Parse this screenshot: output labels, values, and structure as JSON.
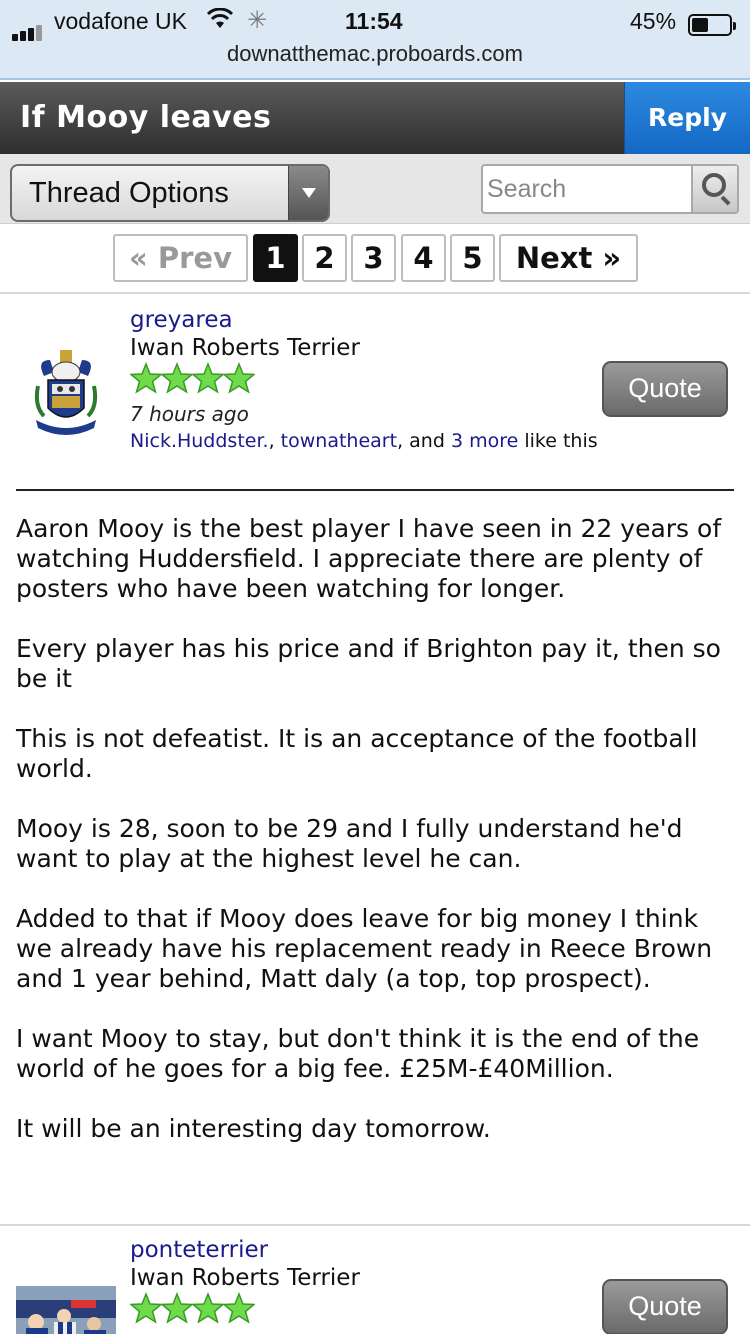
{
  "status_bar": {
    "carrier": "vodafone UK",
    "time": "11:54",
    "battery_percent": "45%",
    "battery_level": 0.45,
    "url": "downatthemac.proboards.com"
  },
  "header": {
    "thread_title": "If Mooy leaves",
    "reply_label": "Reply"
  },
  "options": {
    "thread_options_label": "Thread Options",
    "search_placeholder": "Search"
  },
  "pagination": {
    "prev_label": "« Prev",
    "pages": [
      "1",
      "2",
      "3",
      "4",
      "5"
    ],
    "current_page": "1",
    "next_label": "Next »"
  },
  "posts": [
    {
      "username": "greyarea",
      "rank": "Iwan Roberts Terrier",
      "stars": 4,
      "time": "7 hours ago",
      "likes": {
        "user1": "Nick.Huddster.",
        "sep1": ", ",
        "user2": "townatheart",
        "sep2": ", and ",
        "more": "3 more",
        "suffix": " like this"
      },
      "quote_label": "Quote",
      "paragraphs": [
        "Aaron Mooy is the best player I have seen in 22 years of watching Huddersfield. I appreciate there are plenty of posters who have been watching for longer.",
        "Every player has his price and if Brighton pay it, then so be it",
        "This is not defeatist. It is an acceptance of the football world.",
        "Mooy is 28, soon to be 29 and I fully understand he'd want to play at the highest level he can.",
        "Added to that if Mooy does leave for big money I think we already have his replacement ready in Reece Brown and 1 year behind, Matt daly (a top, top prospect).",
        "I want Mooy to stay, but don't think it is the end of the world of he goes for a big fee. £25M-£40Million.",
        "It will be an interesting day tomorrow."
      ]
    },
    {
      "username": "ponteterrier",
      "rank": "Iwan Roberts Terrier",
      "stars": 4,
      "quote_label": "Quote"
    }
  ]
}
